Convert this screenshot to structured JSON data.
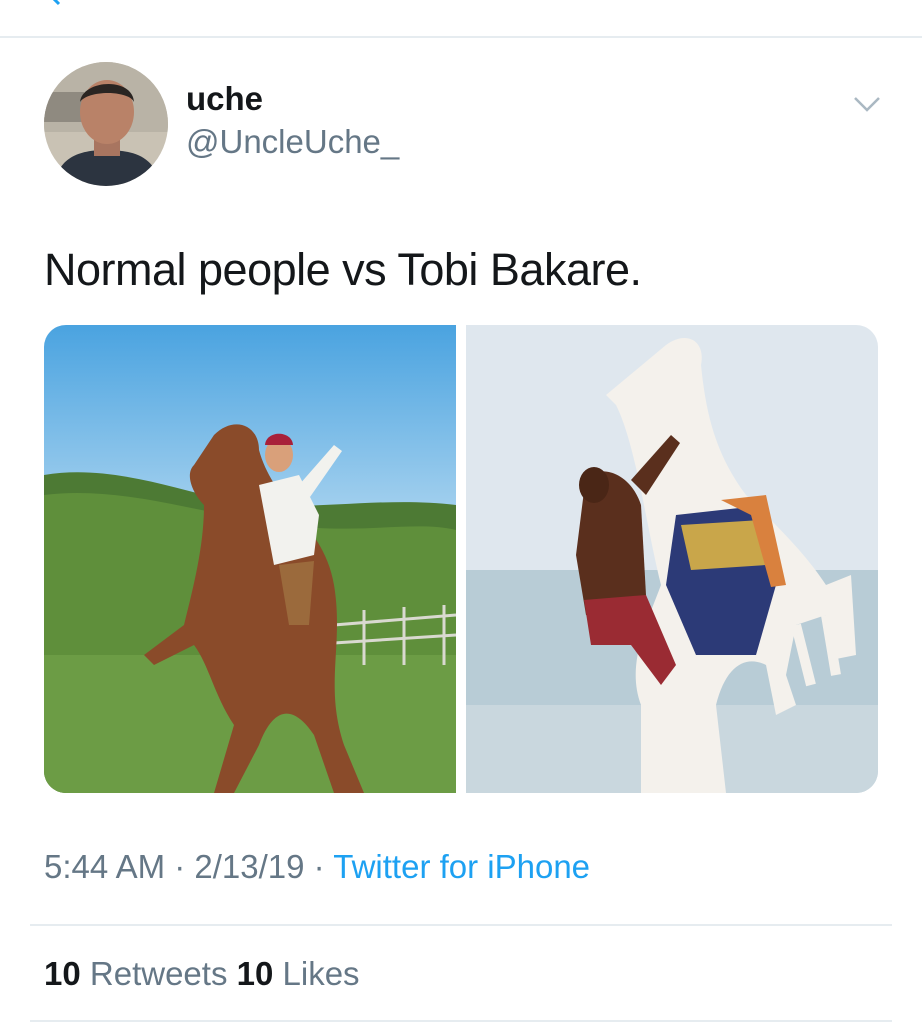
{
  "tweet": {
    "author": {
      "name": "uche",
      "handle": "@UncleUche_"
    },
    "text": "Normal people vs Tobi Bakare.",
    "time": "5:44 AM",
    "date": "2/13/19",
    "separator": " · ",
    "source": "Twitter for iPhone",
    "stats": {
      "retweets_count": "10",
      "retweets_label": "Retweets",
      "likes_count": "10",
      "likes_label": "Likes"
    }
  },
  "colors": {
    "text_primary": "#14171a",
    "text_secondary": "#657786",
    "link": "#1da1f2",
    "divider": "#e6ecf0"
  },
  "icons": {
    "back": "chevron-left-icon",
    "menu": "chevron-down-icon"
  }
}
